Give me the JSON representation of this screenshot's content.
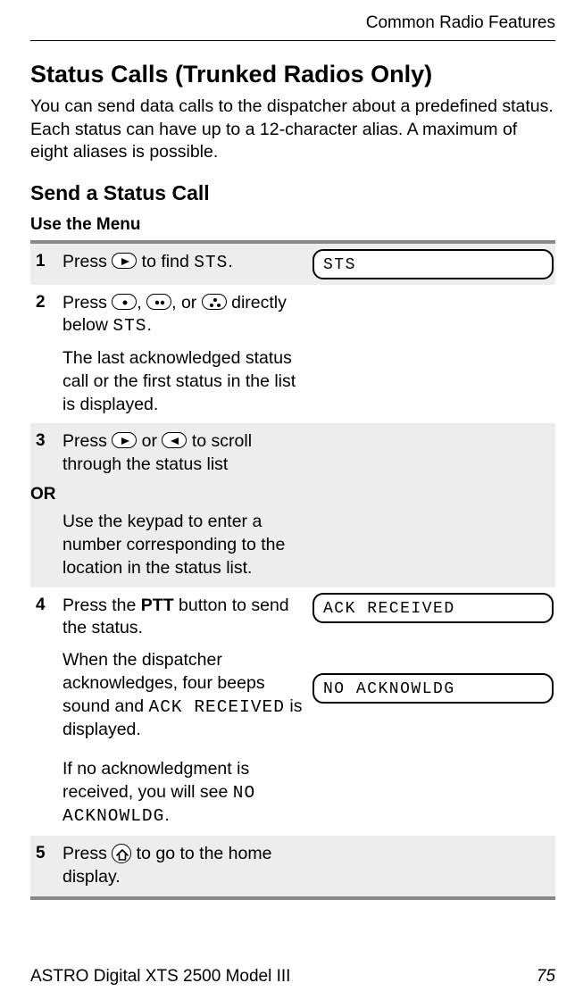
{
  "header": {
    "running": "Common Radio Features"
  },
  "title": "Status Calls (Trunked Radios Only)",
  "intro": "You can send data calls to the dispatcher about a predefined status. Each status can have up to a 12-character alias. A maximum of eight aliases is possible.",
  "section": "Send a Status Call",
  "menu_heading": "Use the Menu",
  "steps": {
    "s1": {
      "num": "1",
      "t1a": "Press ",
      "t1b": " to find ",
      "mono1": "STS",
      "t1c": ".",
      "display": "STS"
    },
    "s2": {
      "num": "2",
      "t1a": "Press ",
      "t1_comma1": ", ",
      "t1_comma2": ", or ",
      "t1b": " directly below ",
      "mono1": "STS",
      "t1c": ".",
      "t2": "The last acknowledged status call or the first status in the list is displayed."
    },
    "s3": {
      "num": "3",
      "t1a": "Press ",
      "t1_or": " or ",
      "t1b": " to scroll through the status list",
      "or_label": "OR",
      "t2": "Use the keypad to enter a number corresponding to the location in the status list."
    },
    "s4": {
      "num": "4",
      "t1a": "Press the ",
      "ptt": "PTT",
      "t1b": " button to send the status.",
      "t2a": "When the dispatcher acknowledges, four beeps sound and ",
      "mono2": "ACK RECEIVED",
      "t2b": " is displayed.",
      "display1": "ACK RECEIVED",
      "t3a": "If no acknowledgment is received, you will see ",
      "mono3": "NO ACKNOWLDG",
      "t3b": ".",
      "display2": "NO ACKNOWLDG"
    },
    "s5": {
      "num": "5",
      "t1a": "Press ",
      "t1b": " to go to the home display."
    }
  },
  "footer": {
    "product": "ASTRO Digital XTS 2500 Model III",
    "page": "75"
  },
  "icons": {
    "arrow_right": "arrow-right-key",
    "arrow_left": "arrow-left-key",
    "dot1": "softkey-dot1",
    "dot2": "softkey-dot2",
    "dot3": "softkey-dot3",
    "home": "home-key"
  }
}
